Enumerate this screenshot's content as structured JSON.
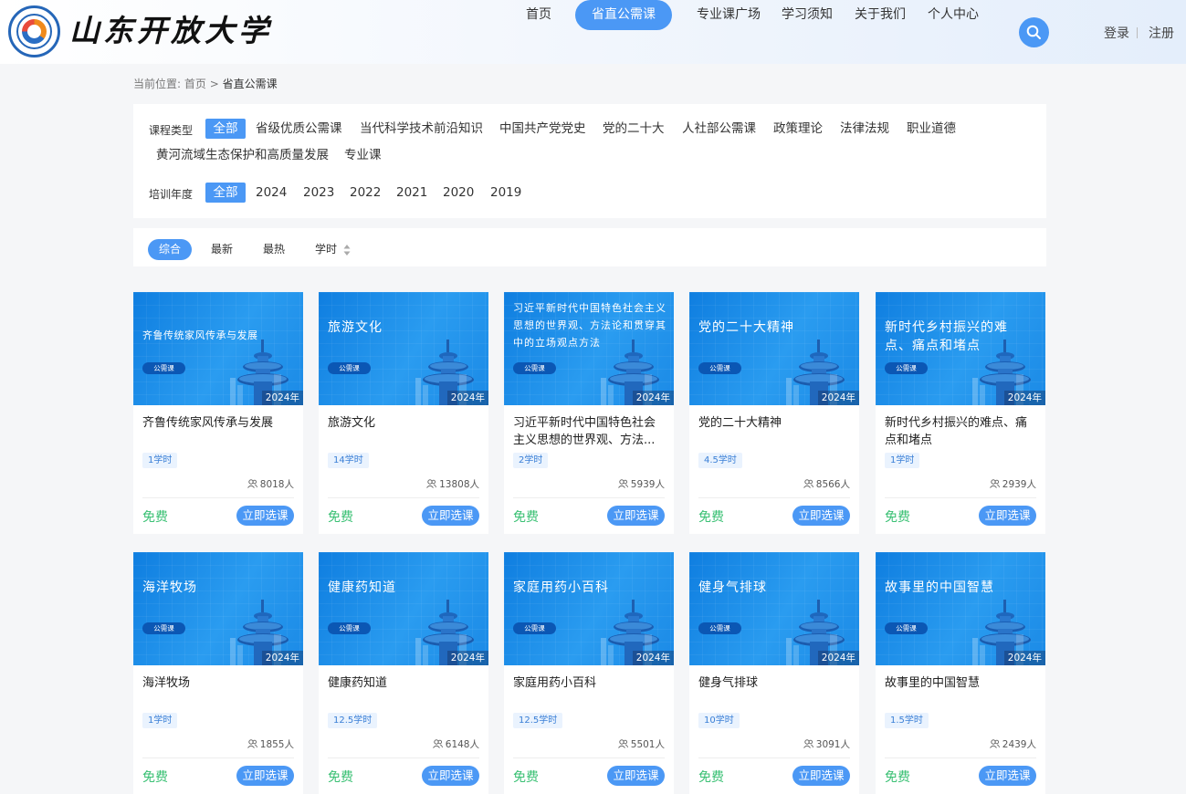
{
  "header": {
    "logo_text": "山东开放大学",
    "nav": [
      "首页",
      "省直公需课",
      "专业课广场",
      "学习须知",
      "关于我们",
      "个人中心"
    ],
    "active_nav": "省直公需课",
    "login": "登录",
    "register": "注册"
  },
  "breadcrumb": {
    "prefix": "当前位置:",
    "home": "首页",
    "separator": ">",
    "current": "省直公需课"
  },
  "filters": {
    "type_label": "课程类型",
    "types": [
      "全部",
      "省级优质公需课",
      "当代科学技术前沿知识",
      "中国共产党党史",
      "党的二十大",
      "人社部公需课",
      "政策理论",
      "法律法规",
      "职业道德",
      "黄河流域生态保护和高质量发展",
      "专业课"
    ],
    "year_label": "培训年度",
    "years": [
      "全部",
      "2024",
      "2023",
      "2022",
      "2021",
      "2020",
      "2019"
    ],
    "active_type": "全部",
    "active_year": "全部"
  },
  "sort": {
    "options": [
      "综合",
      "最新",
      "最热",
      "学时"
    ],
    "active": "综合"
  },
  "course_badge": "公需课",
  "price_label": "免费",
  "enroll_label": "立即选课",
  "colors": {
    "accent": "#4b98f5",
    "free": "#39c073",
    "badge_bg": "#0b57b4"
  },
  "courses": [
    {
      "thumb_title": "齐鲁传统家风传承与发展",
      "title": "齐鲁传统家风传承与发展",
      "year": "2024年",
      "hours": "1学时",
      "learners": "8018人"
    },
    {
      "thumb_title": "旅游文化",
      "title": "旅游文化",
      "year": "2024年",
      "hours": "14学时",
      "learners": "13808人"
    },
    {
      "thumb_title": "习近平新时代中国特色社会主义思想的世界观、方法论和贯穿其中的立场观点方法",
      "title": "习近平新时代中国特色社会主义思想的世界观、方法...",
      "year": "2024年",
      "hours": "2学时",
      "learners": "5939人"
    },
    {
      "thumb_title": "党的二十大精神",
      "title": "党的二十大精神",
      "year": "2024年",
      "hours": "4.5学时",
      "learners": "8566人"
    },
    {
      "thumb_title": "新时代乡村振兴的难点、痛点和堵点",
      "title": "新时代乡村振兴的难点、痛点和堵点",
      "year": "2024年",
      "hours": "1学时",
      "learners": "2939人"
    },
    {
      "thumb_title": "海洋牧场",
      "title": "海洋牧场",
      "year": "2024年",
      "hours": "1学时",
      "learners": "1855人"
    },
    {
      "thumb_title": "健康药知道",
      "title": "健康药知道",
      "year": "2024年",
      "hours": "12.5学时",
      "learners": "6148人"
    },
    {
      "thumb_title": "家庭用药小百科",
      "title": "家庭用药小百科",
      "year": "2024年",
      "hours": "12.5学时",
      "learners": "5501人"
    },
    {
      "thumb_title": "健身气排球",
      "title": "健身气排球",
      "year": "2024年",
      "hours": "10学时",
      "learners": "3091人"
    },
    {
      "thumb_title": "故事里的中国智慧",
      "title": "故事里的中国智慧",
      "year": "2024年",
      "hours": "1.5学时",
      "learners": "2439人"
    }
  ]
}
